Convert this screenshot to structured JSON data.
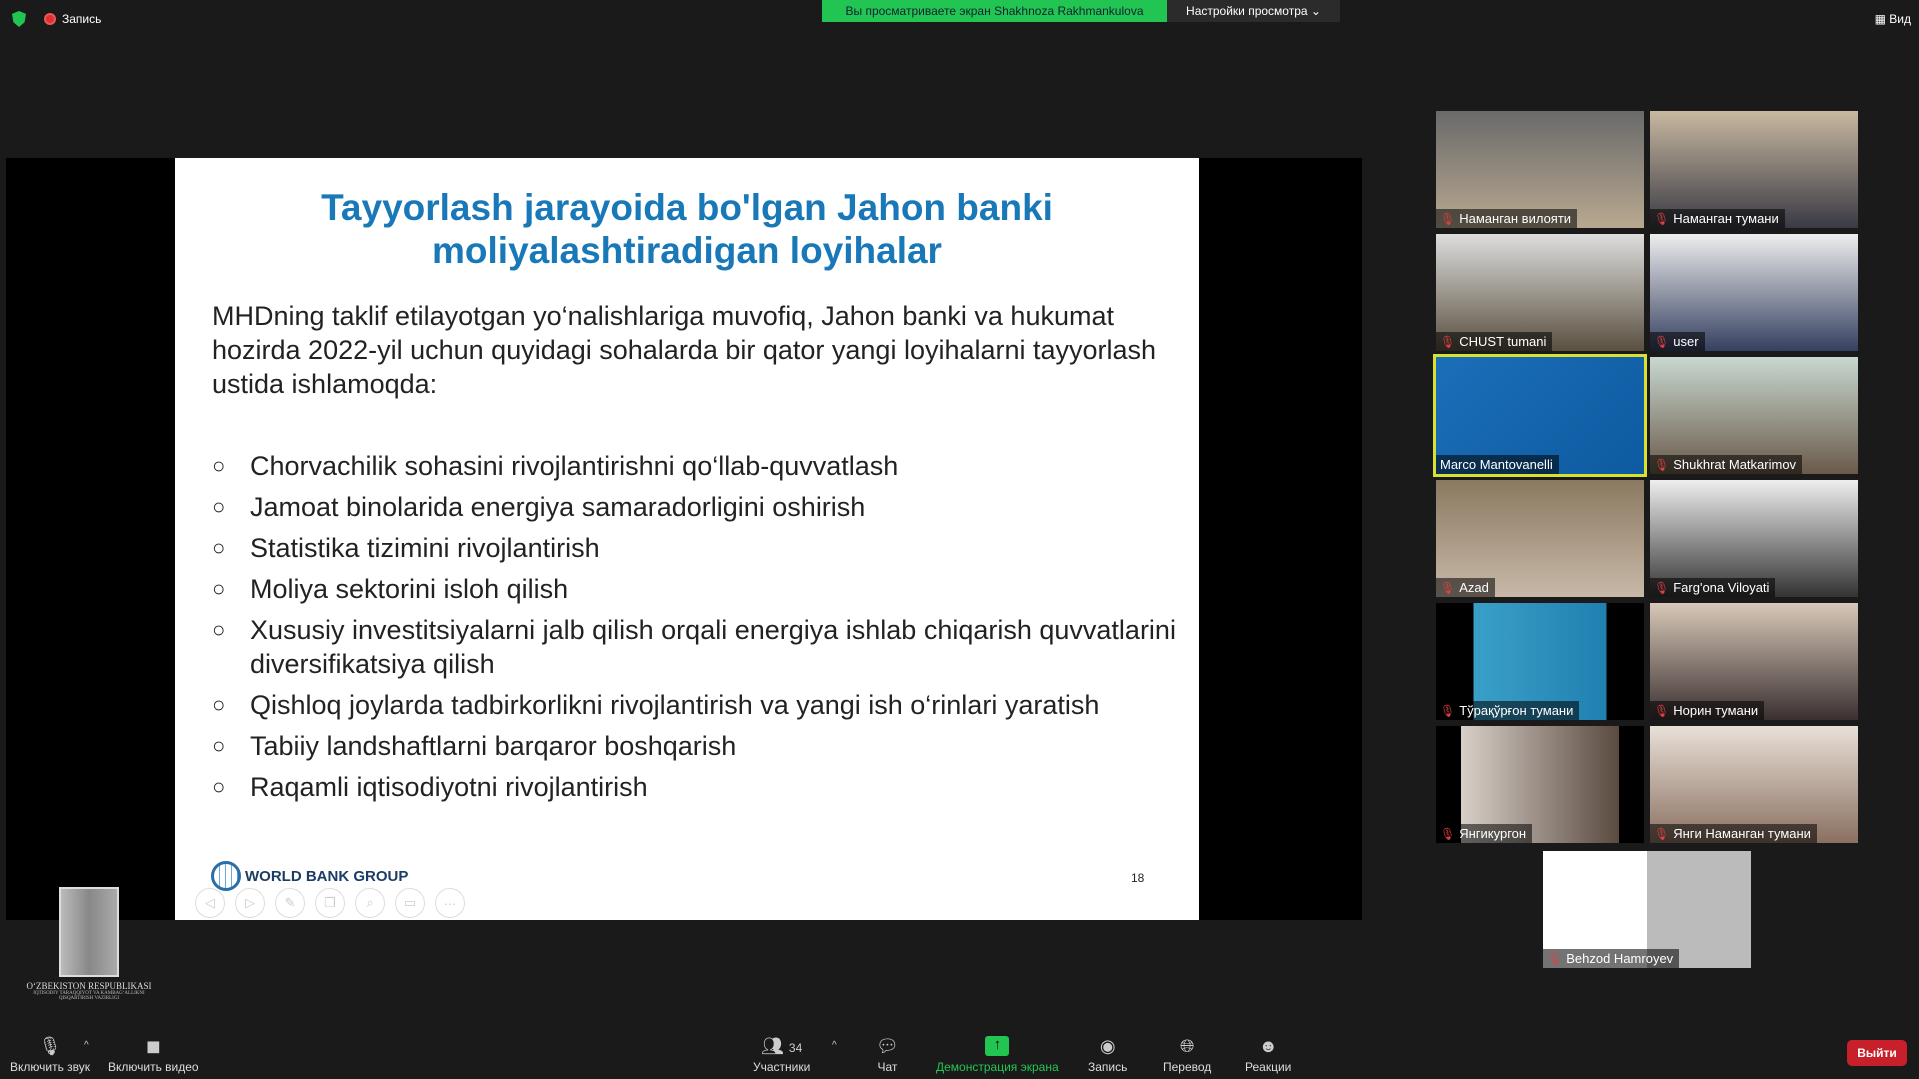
{
  "topbar": {
    "recording": "Запись",
    "banner": "Вы просматриваете экран Shakhnoza Rakhmankulova",
    "view_settings": "Настройки просмотра ⌄",
    "view": "Вид"
  },
  "slide": {
    "title": "Tayyorlash jarayoida bo'lgan Jahon banki moliyalashtiradigan loyihalar",
    "paragraph": "MHDning taklif etilayotgan yo‘nalishlariga muvofiq, Jahon banki va hukumat hozirda 2022-yil uchun quyidagi sohalarda bir qator yangi loyihalarni tayyorlash ustida ishlamoqda:",
    "bullets": [
      "Chorvachilik sohasini rivojlantirishni qo‘llab-quvvatlash",
      "Jamoat binolarida energiya samaradorligini oshirish",
      "Statistika tizimini rivojlantirish",
      "Moliya sektorini isloh qilish",
      "Xususiy investitsiyalarni jalb qilish orqali energiya ishlab chiqarish quvvatlarini diversifikatsiya qilish",
      "Qishloq joylarda tadbirkorlikni rivojlantirish va yangi ish o‘rinlari yaratish",
      "Tabiiy landshaftlarni barqaror boshqarish",
      "Raqamli iqtisodiyotni rivojlantirish"
    ],
    "bullet_marker": "○",
    "logo": "WORLD BANK GROUP",
    "page_number": "18"
  },
  "ministry_logo": {
    "title": "O‘ZBEKISTON RESPUBLIKASI",
    "subtitle": "IQTISODIY TARAQQIYOT VA KAMBAG‘ALLIKNI QISQARTIRISH VAZIRLIGI"
  },
  "participants": [
    {
      "name": "Наманган вилояти",
      "muted": true
    },
    {
      "name": "Наманган тумани",
      "muted": true
    },
    {
      "name": "CHUST tumani",
      "muted": true
    },
    {
      "name": "user",
      "muted": true
    },
    {
      "name": "Marco Mantovanelli",
      "muted": false,
      "active": true
    },
    {
      "name": "Shukhrat Matkarimov",
      "muted": true
    },
    {
      "name": "Azad",
      "muted": true
    },
    {
      "name": "Farg'ona Viloyati",
      "muted": true
    },
    {
      "name": "Тўрақўрғон тумани",
      "muted": true
    },
    {
      "name": "Норин тумани",
      "muted": true
    },
    {
      "name": "Янгикургон",
      "muted": true
    },
    {
      "name": "Янги Наманган тумани",
      "muted": true
    },
    {
      "name": "Behzod Hamroyev",
      "muted": true
    }
  ],
  "toolbar": {
    "unmute": "Включить звук",
    "video": "Включить видео",
    "participants": "Участники",
    "participants_count": "34",
    "chat": "Чат",
    "share": "Демонстрация экрана",
    "record": "Запись",
    "translate": "Перевод",
    "reactions": "Реакции",
    "leave": "Выйти"
  },
  "colors": {
    "accent_green": "#23c552",
    "leave_red": "#c8202a",
    "title_blue": "#1878b8"
  }
}
